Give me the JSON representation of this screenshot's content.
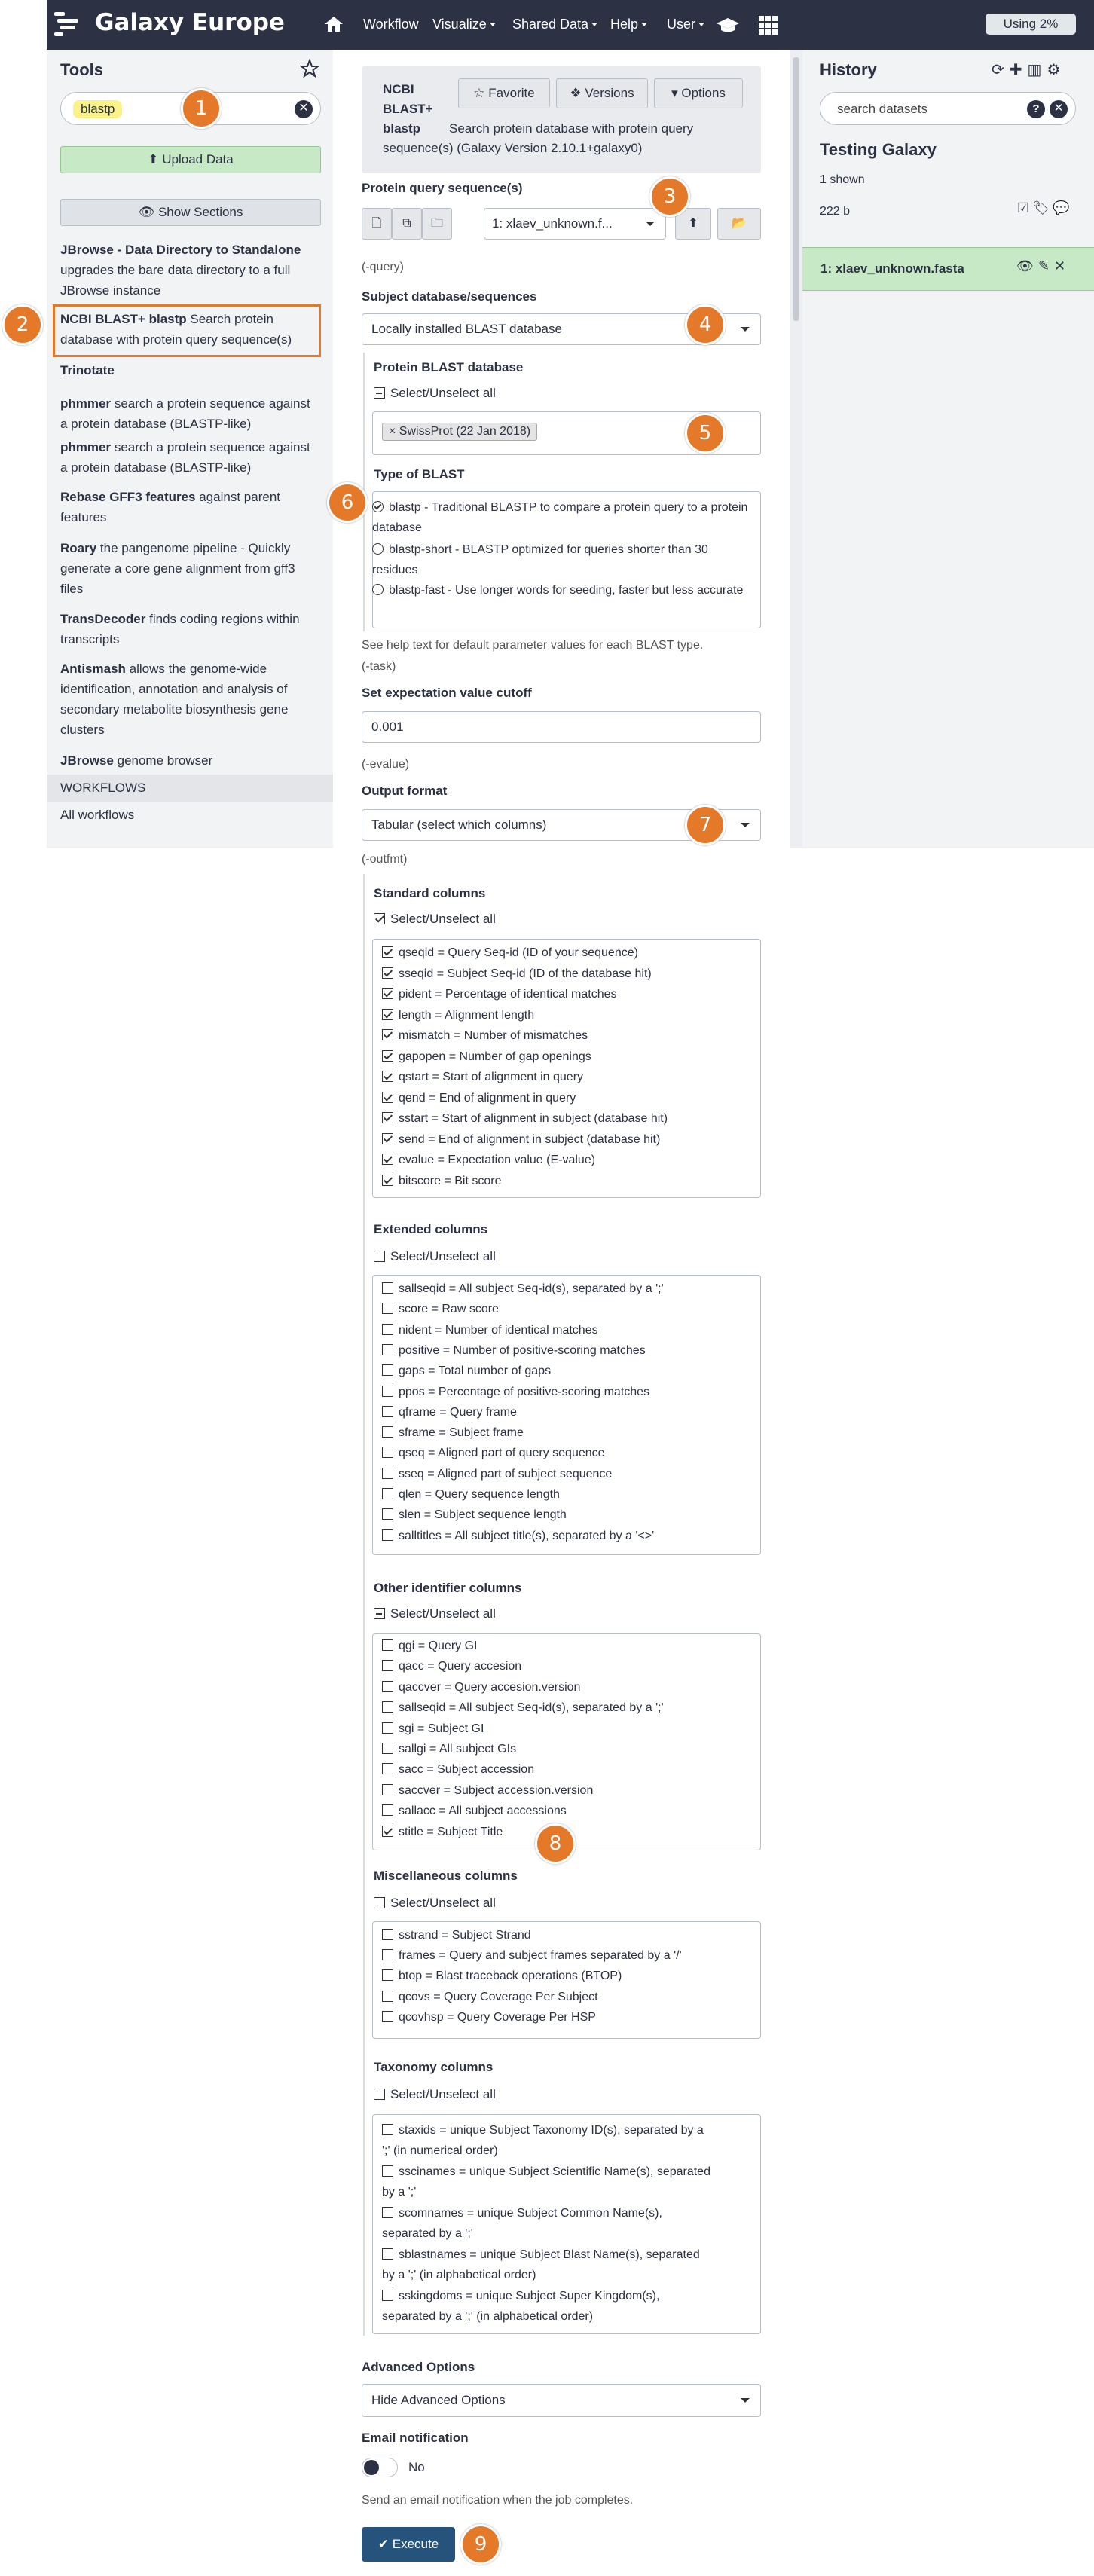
{
  "header": {
    "brand": "Galaxy Europe",
    "nav": {
      "workflow": "Workflow",
      "visualize": "Visualize",
      "shared_data": "Shared Data",
      "help": "Help",
      "user": "User"
    },
    "usage": "Using 2%"
  },
  "tools": {
    "title": "Tools",
    "search_value": "blastp",
    "upload": "Upload Data",
    "show_sections": "Show Sections",
    "items": [
      {
        "name": "JBrowse - Data Directory to Standalone",
        "desc": "upgrades the bare data directory to a full JBrowse instance"
      },
      {
        "name": "NCBI BLAST+ blastp",
        "desc": "Search protein database with protein query sequence(s)"
      },
      {
        "name": "Trinotate",
        "desc": ""
      },
      {
        "name": "phmmer",
        "desc": "search a protein sequence against a protein database (BLASTP-like)"
      },
      {
        "name": "phmmer",
        "desc": "search a protein sequence against a protein database (BLASTP-like)"
      },
      {
        "name": "Rebase GFF3 features",
        "desc": "against parent features"
      },
      {
        "name": "Roary",
        "desc": "the pangenome pipeline - Quickly generate a core gene alignment from gff3 files"
      },
      {
        "name": "TransDecoder",
        "desc": "finds coding regions within transcripts"
      },
      {
        "name": "Antismash",
        "desc": "allows the genome-wide identification, annotation and analysis of secondary metabolite biosynthesis gene clusters"
      },
      {
        "name": "JBrowse",
        "desc": "genome browser"
      }
    ],
    "workflows_header": "WORKFLOWS",
    "all_workflows": "All workflows"
  },
  "form": {
    "tool_title_name": "NCBI BLAST+ blastp",
    "tool_title_desc": "Search protein database with protein query sequence(s) (Galaxy Version 2.10.1+galaxy0)",
    "favorite": "Favorite",
    "versions": "Versions",
    "options": "Options",
    "query_label": "Protein query sequence(s)",
    "query_value": "1: xlaev_unknown.f...",
    "query_note": "(-query)",
    "subject_label": "Subject database/sequences",
    "subject_value": "Locally installed BLAST database",
    "db_label": "Protein BLAST database",
    "select_unselect": "Select/Unselect all",
    "db_chip": "SwissProt (22 Jan 2018)",
    "type_label": "Type of BLAST",
    "types": [
      "blastp - Traditional BLASTP to compare a protein query to a protein database",
      "blastp-short - BLASTP optimized for queries shorter than 30 residues",
      "blastp-fast - Use longer words for seeding, faster but less accurate"
    ],
    "type_help": "See help text for default parameter values for each BLAST type.",
    "task_note": "(-task)",
    "evalue_label": "Set expectation value cutoff",
    "evalue_value": "0.001",
    "evalue_note": "(-evalue)",
    "output_label": "Output format",
    "output_value": "Tabular (select which columns)",
    "outfmt_note": "(-outfmt)",
    "standard_head": "Standard columns",
    "standard": [
      "qseqid = Query Seq-id (ID of your sequence)",
      "sseqid = Subject Seq-id (ID of the database hit)",
      "pident = Percentage of identical matches",
      "length = Alignment length",
      "mismatch = Number of mismatches",
      "gapopen = Number of gap openings",
      "qstart = Start of alignment in query",
      "qend = End of alignment in query",
      "sstart = Start of alignment in subject (database hit)",
      "send = End of alignment in subject (database hit)",
      "evalue = Expectation value (E-value)",
      "bitscore = Bit score"
    ],
    "extended_head": "Extended columns",
    "extended": [
      "sallseqid = All subject Seq-id(s), separated by a ';'",
      "score = Raw score",
      "nident = Number of identical matches",
      "positive = Number of positive-scoring matches",
      "gaps = Total number of gaps",
      "ppos = Percentage of positive-scoring matches",
      "qframe = Query frame",
      "sframe = Subject frame",
      "qseq = Aligned part of query sequence",
      "sseq = Aligned part of subject sequence",
      "qlen = Query sequence length",
      "slen = Subject sequence length",
      "salltitles = All subject title(s), separated by a '<>'"
    ],
    "other_head": "Other identifier columns",
    "other": [
      "qgi = Query GI",
      "qacc = Query accesion",
      "qaccver = Query accesion.version",
      "sallseqid = All subject Seq-id(s), separated by a ';'",
      "sgi = Subject GI",
      "sallgi = All subject GIs",
      "sacc = Subject accession",
      "saccver = Subject accession.version",
      "sallacc = All subject accessions",
      "stitle = Subject Title"
    ],
    "misc_head": "Miscellaneous columns",
    "misc": [
      "sstrand = Subject Strand",
      "frames = Query and subject frames separated by a '/'",
      "btop = Blast traceback operations (BTOP)",
      "qcovs = Query Coverage Per Subject",
      "qcovhsp = Query Coverage Per HSP"
    ],
    "tax_head": "Taxonomy columns",
    "tax": [
      [
        "staxids = unique Subject Taxonomy ID(s), separated by a",
        "';' (in numerical order)"
      ],
      [
        "sscinames = unique Subject Scientific Name(s), separated",
        "by a ';'"
      ],
      [
        "scomnames = unique Subject Common Name(s),",
        "separated by a ';'"
      ],
      [
        "sblastnames = unique Subject Blast Name(s), separated",
        "by a ';' (in alphabetical order)"
      ],
      [
        "sskingdoms = unique Subject Super Kingdom(s),",
        "separated by a ';' (in alphabetical order)"
      ]
    ],
    "advanced_label": "Advanced Options",
    "advanced_value": "Hide Advanced Options",
    "email_label": "Email notification",
    "email_toggle": "No",
    "email_help": "Send an email notification when the job completes.",
    "execute": "Execute"
  },
  "history": {
    "title": "History",
    "search_placeholder": "search datasets",
    "name": "Testing Galaxy",
    "shown": "1 shown",
    "size": "222 b",
    "dataset": "1: xlaev_unknown.fasta"
  },
  "badges": [
    "1",
    "2",
    "3",
    "4",
    "5",
    "6",
    "7",
    "8",
    "9"
  ],
  "colors": {
    "navbar": "#2c3143",
    "badge": "#e5792a",
    "dataset_ok": "#c7e9c6",
    "execute": "#25537b"
  }
}
